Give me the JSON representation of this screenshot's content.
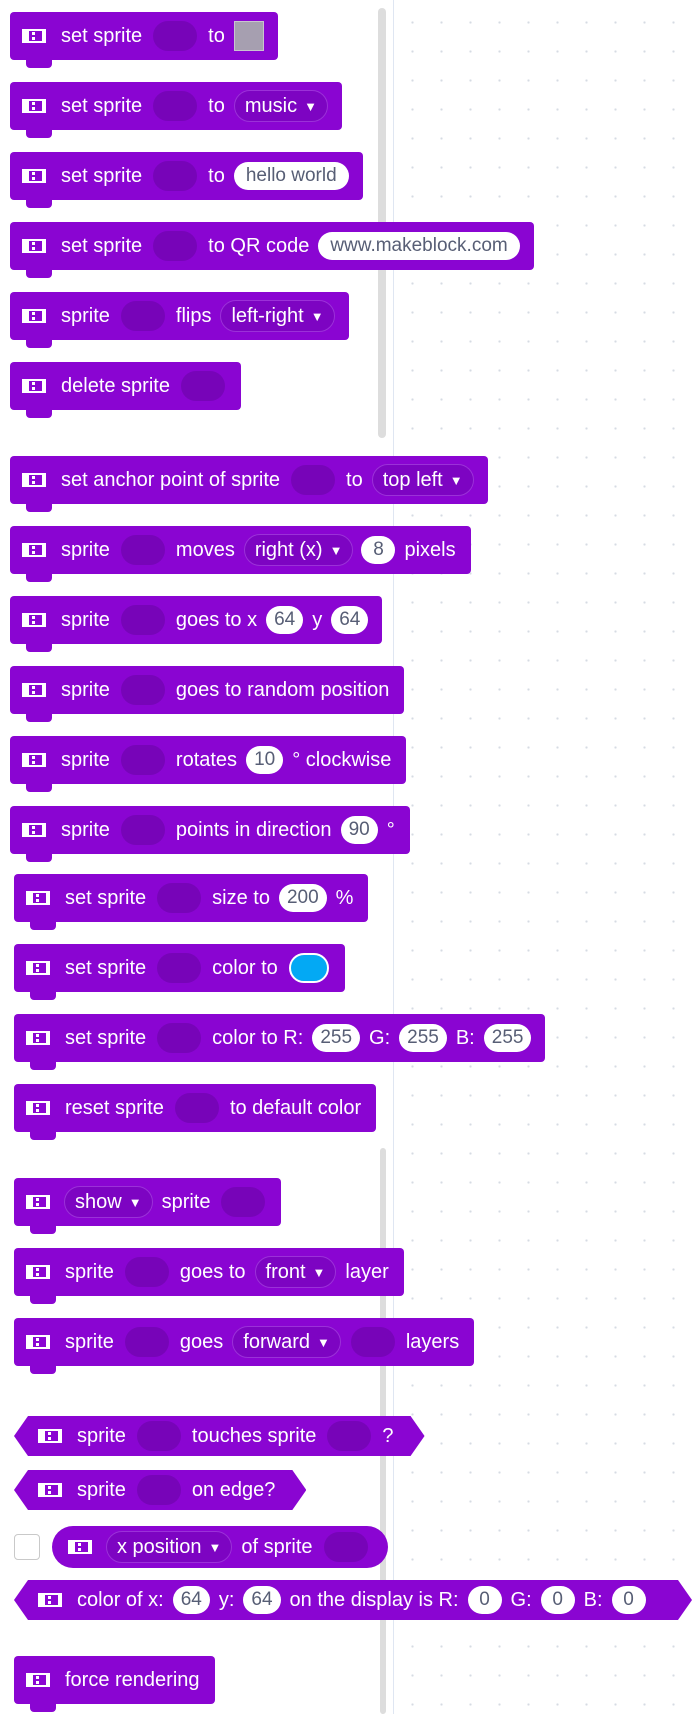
{
  "palette": {
    "block_color": "#8a05d2",
    "slot_color": "#7704b8",
    "color_swatch": "#03a9f4",
    "image_swatch": "#a69fb0"
  },
  "icon": "sprite-icon",
  "blocks": {
    "b1": {
      "t1": "set sprite",
      "t2": "to"
    },
    "b2": {
      "t1": "set sprite",
      "t2": "to",
      "dd": "music"
    },
    "b3": {
      "t1": "set sprite",
      "t2": "to",
      "str": "hello world"
    },
    "b4": {
      "t1": "set sprite",
      "t2": "to QR code",
      "str": "www.makeblock.com"
    },
    "b5": {
      "t1": "sprite",
      "t2": "flips",
      "dd": "left-right"
    },
    "b6": {
      "t1": "delete sprite"
    },
    "b7": {
      "t1": "set anchor point of sprite",
      "t2": "to",
      "dd": "top left"
    },
    "b8": {
      "t1": "sprite",
      "t2": "moves",
      "dd": "right (x)",
      "n1": "8",
      "t3": "pixels"
    },
    "b9": {
      "t1": "sprite",
      "t2": "goes to x",
      "n1": "64",
      "t3": "y",
      "n2": "64"
    },
    "b10": {
      "t1": "sprite",
      "t2": "goes to random position"
    },
    "b11": {
      "t1": "sprite",
      "t2": "rotates",
      "n1": "10",
      "t3": "° clockwise"
    },
    "b12": {
      "t1": "sprite",
      "t2": "points in direction",
      "n1": "90",
      "t3": "°"
    },
    "b13": {
      "t1": "set sprite",
      "t2": "size to",
      "n1": "200",
      "t3": "%"
    },
    "b14": {
      "t1": "set sprite",
      "t2": "color to"
    },
    "b15": {
      "t1": "set sprite",
      "t2": "color to R:",
      "n1": "255",
      "t3": "G:",
      "n2": "255",
      "t4": "B:",
      "n3": "255"
    },
    "b16": {
      "t1": "reset sprite",
      "t2": "to default color"
    },
    "b17": {
      "dd": "show",
      "t1": "sprite"
    },
    "b18": {
      "t1": "sprite",
      "t2": "goes to",
      "dd": "front",
      "t3": "layer"
    },
    "b19": {
      "t1": "sprite",
      "t2": "goes",
      "dd": "forward",
      "t3": "layers"
    },
    "b20": {
      "t1": "sprite",
      "t2": "touches sprite",
      "t3": "?"
    },
    "b21": {
      "t1": "sprite",
      "t2": "on edge?"
    },
    "b22": {
      "dd": "x position",
      "t1": "of sprite"
    },
    "b23": {
      "t1": "color of x:",
      "n1": "64",
      "t2": "y:",
      "n2": "64",
      "t3": "on the display is R:",
      "n3": "0",
      "t4": "G:",
      "n4": "0",
      "t5": "B:",
      "n5": "0"
    },
    "b24": {
      "t1": "force rendering"
    }
  }
}
